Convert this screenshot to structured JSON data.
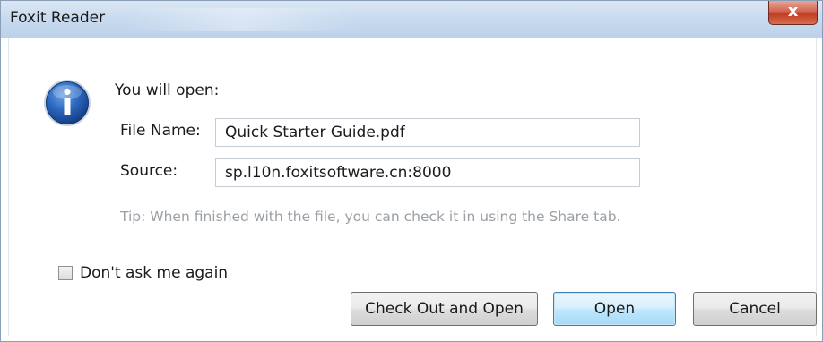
{
  "window": {
    "title": "Foxit Reader",
    "close_glyph": "x"
  },
  "dialog": {
    "heading": "You will open:",
    "icon": "info-icon",
    "file_name_label": "File Name:",
    "file_name_value": "Quick Starter Guide.pdf",
    "source_label": "Source:",
    "source_value": "sp.l10n.foxitsoftware.cn:8000",
    "tip": "Tip: When finished with the file, you can check it in using the Share tab.",
    "dont_ask_label": "Don't ask me again",
    "dont_ask_checked": false
  },
  "buttons": {
    "check_out_open": "Check Out and Open",
    "open": "Open",
    "cancel": "Cancel"
  },
  "colors": {
    "titlebar": "#c9dbef",
    "close": "#c23b22",
    "info_icon": "#1f5fb0",
    "tip_text": "#9aa0a6",
    "default_button_border": "#3c7fb1"
  }
}
